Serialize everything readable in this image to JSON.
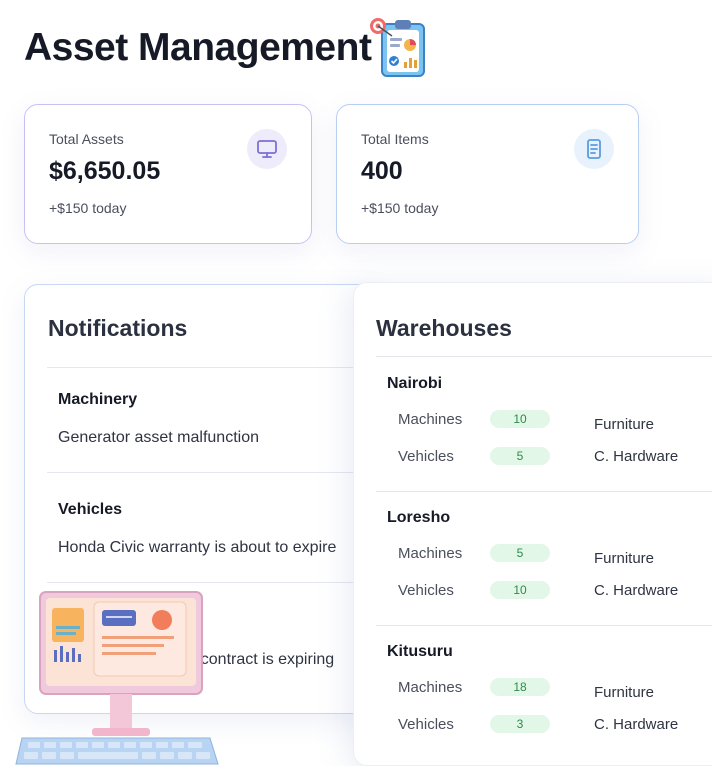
{
  "page": {
    "title": "Asset Management"
  },
  "stats": [
    {
      "label": "Total Assets",
      "value": "$6,650.05",
      "sub": "+$150 today",
      "icon": "monitor-icon",
      "accent": "#7c6fd8"
    },
    {
      "label": "Total Items",
      "value": "400",
      "sub": "+$150 today",
      "icon": "document-icon",
      "accent": "#5a9be0"
    }
  ],
  "notifications": {
    "title": "Notifications",
    "items": [
      {
        "category": "Machinery",
        "message": "Generator asset malfunction"
      },
      {
        "category": "Vehicles",
        "message": "Honda Civic warranty is about to expire"
      },
      {
        "category": "",
        "message": "rs contract is expiring"
      }
    ]
  },
  "warehouses": {
    "title": "Warehouses",
    "items": [
      {
        "name": "Nairobi",
        "machines_label": "Machines",
        "machines": "10",
        "vehicles_label": "Vehicles",
        "vehicles": "5",
        "furniture_label": "Furniture",
        "hardware_label": "C. Hardware"
      },
      {
        "name": "Loresho",
        "machines_label": "Machines",
        "machines": "5",
        "vehicles_label": "Vehicles",
        "vehicles": "10",
        "furniture_label": "Furniture",
        "hardware_label": "C. Hardware"
      },
      {
        "name": "Kitusuru",
        "machines_label": "Machines",
        "machines": "18",
        "vehicles_label": "Vehicles",
        "vehicles": "3",
        "furniture_label": "Furniture",
        "hardware_label": "C. Hardware"
      }
    ]
  },
  "colors": {
    "pill_bg": "#e3f7e8",
    "pill_text": "#2f8a4b",
    "assets_border": "#c9c1f5",
    "items_border": "#b6cff3"
  }
}
